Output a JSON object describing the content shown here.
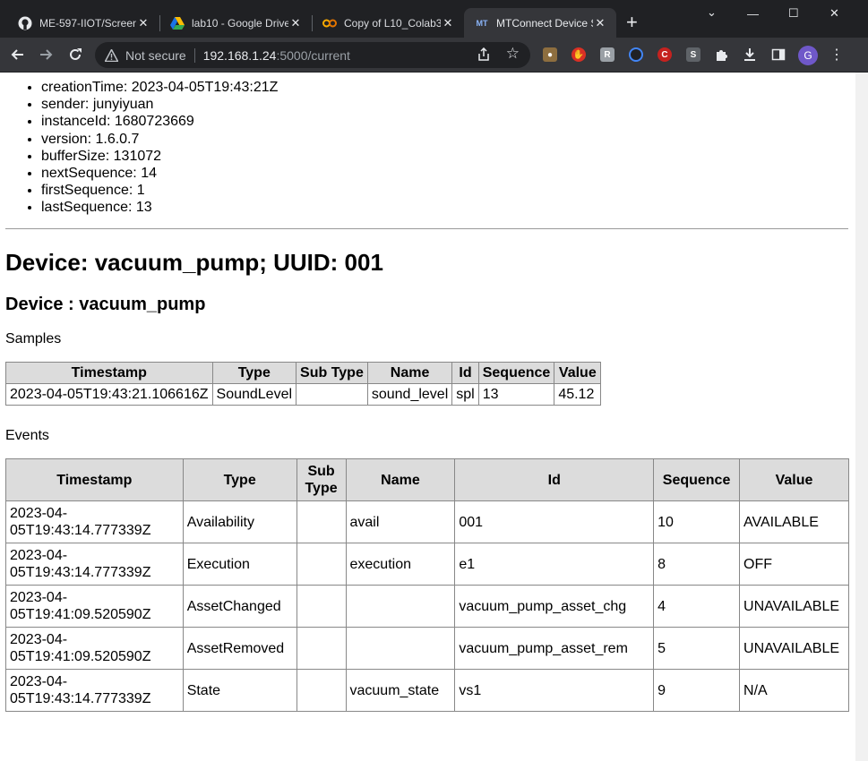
{
  "browser": {
    "tabs": [
      {
        "title": "ME-597-IIOT/Screen",
        "icon": "github-icon"
      },
      {
        "title": "lab10 - Google Drive",
        "icon": "google-drive-icon"
      },
      {
        "title": "Copy of L10_Colab3",
        "icon": "colab-icon"
      },
      {
        "title": "MTConnect Device S",
        "icon": "mtconnect-icon"
      }
    ],
    "security_label": "Not secure",
    "url_host": "192.168.1.24",
    "url_path": ":5000/current",
    "avatar_letter": "G"
  },
  "header": {
    "creationTime": "creationTime: 2023-04-05T19:43:21Z",
    "sender": "sender: junyiyuan",
    "instanceId": "instanceId: 1680723669",
    "version": "version: 1.6.0.7",
    "bufferSize": "bufferSize: 131072",
    "nextSequence": "nextSequence: 14",
    "firstSequence": "firstSequence: 1",
    "lastSequence": "lastSequence: 13"
  },
  "device_title": "Device: vacuum_pump; UUID: 001",
  "component_title": "Device : vacuum_pump",
  "samples": {
    "label": "Samples",
    "headers": [
      "Timestamp",
      "Type",
      "Sub Type",
      "Name",
      "Id",
      "Sequence",
      "Value"
    ],
    "rows": [
      [
        "2023-04-05T19:43:21.106616Z",
        "SoundLevel",
        "",
        "sound_level",
        "spl",
        "13",
        "45.12"
      ]
    ]
  },
  "events": {
    "label": "Events",
    "headers": [
      "Timestamp",
      "Type",
      "Sub Type",
      "Name",
      "Id",
      "Sequence",
      "Value"
    ],
    "rows": [
      [
        "2023-04-05T19:43:14.777339Z",
        "Availability",
        "",
        "avail",
        "001",
        "10",
        "AVAILABLE"
      ],
      [
        "2023-04-05T19:43:14.777339Z",
        "Execution",
        "",
        "execution",
        "e1",
        "8",
        "OFF"
      ],
      [
        "2023-04-05T19:41:09.520590Z",
        "AssetChanged",
        "",
        "",
        "vacuum_pump_asset_chg",
        "4",
        "UNAVAILABLE"
      ],
      [
        "2023-04-05T19:41:09.520590Z",
        "AssetRemoved",
        "",
        "",
        "vacuum_pump_asset_rem",
        "5",
        "UNAVAILABLE"
      ],
      [
        "2023-04-05T19:43:14.777339Z",
        "State",
        "",
        "vacuum_state",
        "vs1",
        "9",
        "N/A"
      ]
    ]
  }
}
